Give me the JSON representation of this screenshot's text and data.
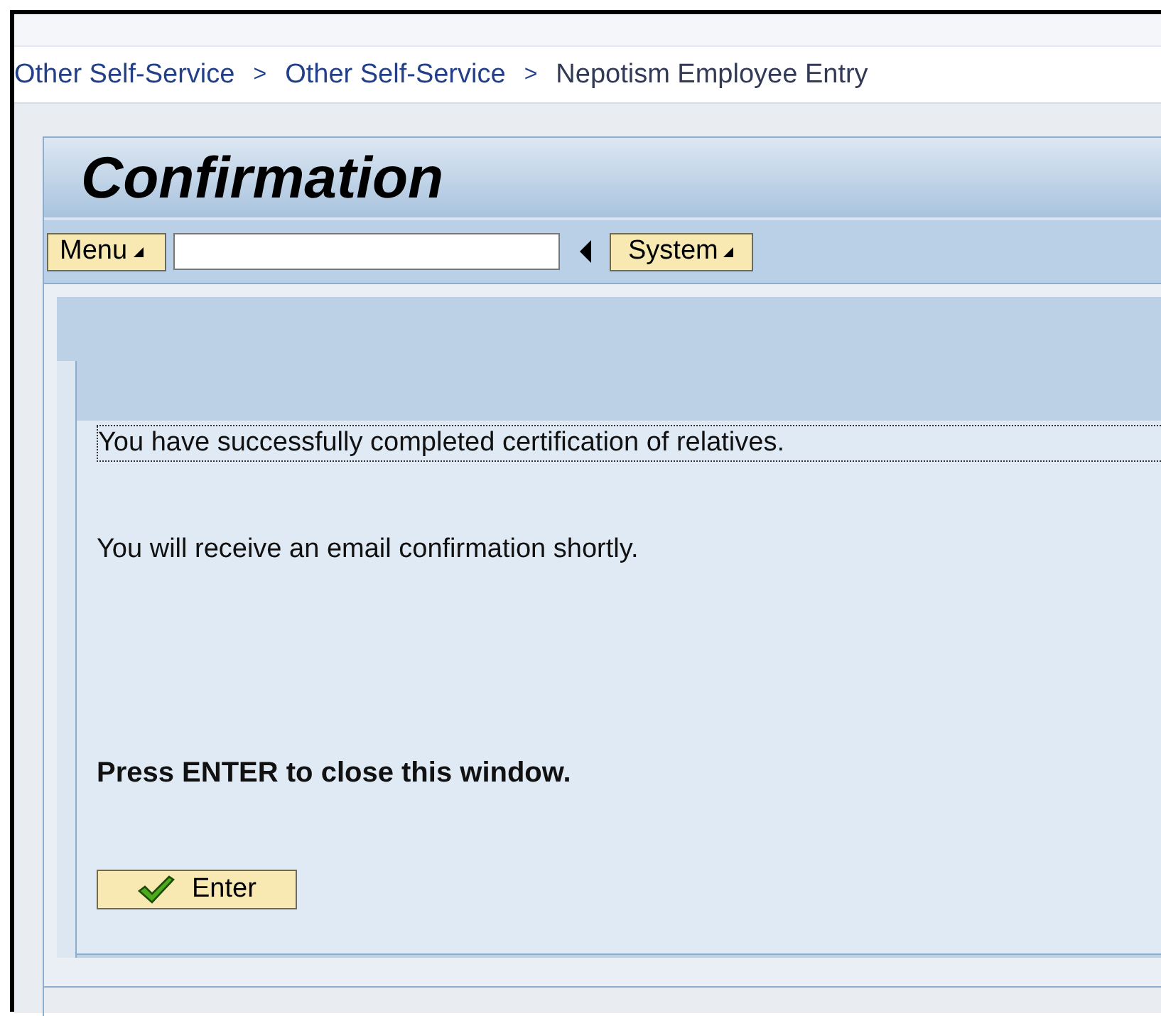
{
  "breadcrumb": [
    {
      "label": "Other Self-Service",
      "kind": "link",
      "separator": ">"
    },
    {
      "label": "Other Self-Service",
      "kind": "link",
      "separator": ">"
    },
    {
      "label": "Nepotism Employee Entry",
      "kind": "current"
    }
  ],
  "title": "Confirmation",
  "toolbar": {
    "menu_button": "Menu",
    "system_button": "System"
  },
  "messages": [
    {
      "text": "You have successfully completed certification of relatives.",
      "kind": "focused"
    },
    {
      "text": "You will receive an email confirmation shortly.",
      "kind": "plain"
    },
    {
      "text": "Press ENTER to close this window.",
      "kind": "bold"
    }
  ],
  "enter_button": "Enter"
}
